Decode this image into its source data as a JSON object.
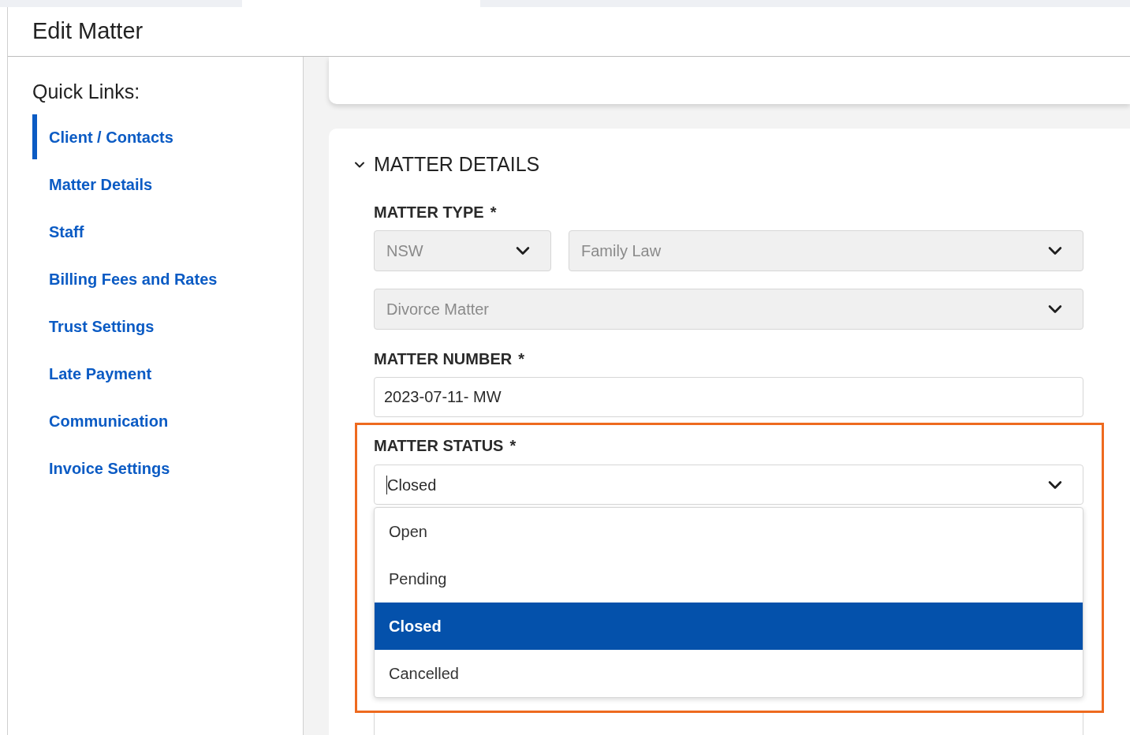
{
  "header": {
    "title": "Edit Matter"
  },
  "quick_links": {
    "title": "Quick Links:",
    "items": [
      {
        "label": "Client / Contacts",
        "selected": true
      },
      {
        "label": "Matter Details",
        "selected": false
      },
      {
        "label": "Staff",
        "selected": false
      },
      {
        "label": "Billing Fees and Rates",
        "selected": false
      },
      {
        "label": "Trust Settings",
        "selected": false
      },
      {
        "label": "Late Payment",
        "selected": false
      },
      {
        "label": "Communication",
        "selected": false
      },
      {
        "label": "Invoice Settings",
        "selected": false
      }
    ]
  },
  "section": {
    "title": "MATTER DETAILS",
    "expanded": true,
    "matter_type": {
      "label": "MATTER TYPE",
      "required_mark": "*",
      "state": {
        "value": "NSW",
        "disabled": true
      },
      "area": {
        "value": "Family Law",
        "disabled": true
      },
      "subtype": {
        "value": "Divorce Matter",
        "disabled": true
      }
    },
    "matter_number": {
      "label": "MATTER NUMBER",
      "required_mark": "*",
      "value": "2023-07-11- MW"
    },
    "matter_status": {
      "label": "MATTER STATUS",
      "required_mark": "*",
      "value": "Closed",
      "focused": true,
      "options": [
        {
          "label": "Open",
          "selected": false
        },
        {
          "label": "Pending",
          "selected": false
        },
        {
          "label": "Closed",
          "selected": true
        },
        {
          "label": "Cancelled",
          "selected": false
        }
      ]
    }
  }
}
